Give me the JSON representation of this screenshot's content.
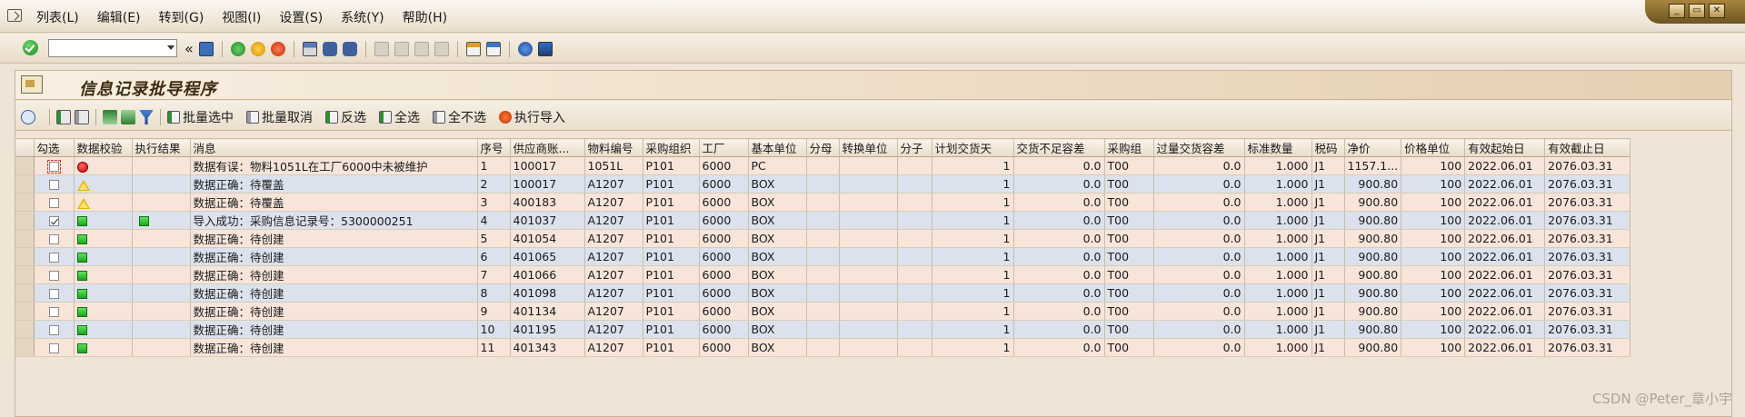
{
  "menubar": {
    "items": [
      "列表(L)",
      "编辑(E)",
      "转到(G)",
      "视图(I)",
      "设置(S)",
      "系统(Y)",
      "帮助(H)"
    ],
    "window_controls": [
      "_",
      "▭",
      "✕"
    ]
  },
  "systoolbar": {
    "command_value": "",
    "nav_symbol": "«"
  },
  "page": {
    "title": "信息记录批导程序"
  },
  "apptoolbar": {
    "items": [
      "批量选中",
      "批量取消",
      "反选",
      "全选",
      "全不选",
      "执行导入"
    ]
  },
  "grid": {
    "columns": [
      "勾选",
      "数据校验",
      "执行结果",
      "消息",
      "序号",
      "供应商账...",
      "物料编号",
      "采购组织",
      "工厂",
      "基本单位",
      "分母",
      "转换单位",
      "分子",
      "计划交货天",
      "交货不足容差",
      "采购组",
      "过量交货容差",
      "标准数量",
      "税码",
      "净价",
      "价格单位",
      "有效起始日",
      "有效截止日"
    ],
    "rows": [
      {
        "checked": false,
        "focus": true,
        "check": "red",
        "result": "",
        "msg": "数据有误：物料1051L在工厂6000中未被维护",
        "seq": "1",
        "vendor": "100017",
        "material": "1051L",
        "porg": "P101",
        "plant": "6000",
        "unit": "PC",
        "denom": "",
        "conv": "",
        "numer": "",
        "days": "1",
        "under": "0.0",
        "pgroup": "T00",
        "over": "0.0",
        "stdqty": "1.000",
        "tax": "J1",
        "price": "1157.1...",
        "punit": "100",
        "from": "2022.06.01",
        "to": "2076.03.31"
      },
      {
        "checked": false,
        "focus": false,
        "check": "yellow",
        "result": "",
        "msg": "数据正确：待覆盖",
        "seq": "2",
        "vendor": "100017",
        "material": "A1207",
        "porg": "P101",
        "plant": "6000",
        "unit": "BOX",
        "denom": "",
        "conv": "",
        "numer": "",
        "days": "1",
        "under": "0.0",
        "pgroup": "T00",
        "over": "0.0",
        "stdqty": "1.000",
        "tax": "J1",
        "price": "900.80",
        "punit": "100",
        "from": "2022.06.01",
        "to": "2076.03.31"
      },
      {
        "checked": false,
        "focus": false,
        "check": "yellow",
        "result": "",
        "msg": "数据正确：待覆盖",
        "seq": "3",
        "vendor": "400183",
        "material": "A1207",
        "porg": "P101",
        "plant": "6000",
        "unit": "BOX",
        "denom": "",
        "conv": "",
        "numer": "",
        "days": "1",
        "under": "0.0",
        "pgroup": "T00",
        "over": "0.0",
        "stdqty": "1.000",
        "tax": "J1",
        "price": "900.80",
        "punit": "100",
        "from": "2022.06.01",
        "to": "2076.03.31"
      },
      {
        "checked": true,
        "focus": false,
        "check": "green",
        "result": "green",
        "msg": "导入成功：采购信息记录号：5300000251",
        "seq": "4",
        "vendor": "401037",
        "material": "A1207",
        "porg": "P101",
        "plant": "6000",
        "unit": "BOX",
        "denom": "",
        "conv": "",
        "numer": "",
        "days": "1",
        "under": "0.0",
        "pgroup": "T00",
        "over": "0.0",
        "stdqty": "1.000",
        "tax": "J1",
        "price": "900.80",
        "punit": "100",
        "from": "2022.06.01",
        "to": "2076.03.31"
      },
      {
        "checked": false,
        "focus": false,
        "check": "green",
        "result": "",
        "msg": "数据正确：待创建",
        "seq": "5",
        "vendor": "401054",
        "material": "A1207",
        "porg": "P101",
        "plant": "6000",
        "unit": "BOX",
        "denom": "",
        "conv": "",
        "numer": "",
        "days": "1",
        "under": "0.0",
        "pgroup": "T00",
        "over": "0.0",
        "stdqty": "1.000",
        "tax": "J1",
        "price": "900.80",
        "punit": "100",
        "from": "2022.06.01",
        "to": "2076.03.31"
      },
      {
        "checked": false,
        "focus": false,
        "check": "green",
        "result": "",
        "msg": "数据正确：待创建",
        "seq": "6",
        "vendor": "401065",
        "material": "A1207",
        "porg": "P101",
        "plant": "6000",
        "unit": "BOX",
        "denom": "",
        "conv": "",
        "numer": "",
        "days": "1",
        "under": "0.0",
        "pgroup": "T00",
        "over": "0.0",
        "stdqty": "1.000",
        "tax": "J1",
        "price": "900.80",
        "punit": "100",
        "from": "2022.06.01",
        "to": "2076.03.31"
      },
      {
        "checked": false,
        "focus": false,
        "check": "green",
        "result": "",
        "msg": "数据正确：待创建",
        "seq": "7",
        "vendor": "401066",
        "material": "A1207",
        "porg": "P101",
        "plant": "6000",
        "unit": "BOX",
        "denom": "",
        "conv": "",
        "numer": "",
        "days": "1",
        "under": "0.0",
        "pgroup": "T00",
        "over": "0.0",
        "stdqty": "1.000",
        "tax": "J1",
        "price": "900.80",
        "punit": "100",
        "from": "2022.06.01",
        "to": "2076.03.31"
      },
      {
        "checked": false,
        "focus": false,
        "check": "green",
        "result": "",
        "msg": "数据正确：待创建",
        "seq": "8",
        "vendor": "401098",
        "material": "A1207",
        "porg": "P101",
        "plant": "6000",
        "unit": "BOX",
        "denom": "",
        "conv": "",
        "numer": "",
        "days": "1",
        "under": "0.0",
        "pgroup": "T00",
        "over": "0.0",
        "stdqty": "1.000",
        "tax": "J1",
        "price": "900.80",
        "punit": "100",
        "from": "2022.06.01",
        "to": "2076.03.31"
      },
      {
        "checked": false,
        "focus": false,
        "check": "green",
        "result": "",
        "msg": "数据正确：待创建",
        "seq": "9",
        "vendor": "401134",
        "material": "A1207",
        "porg": "P101",
        "plant": "6000",
        "unit": "BOX",
        "denom": "",
        "conv": "",
        "numer": "",
        "days": "1",
        "under": "0.0",
        "pgroup": "T00",
        "over": "0.0",
        "stdqty": "1.000",
        "tax": "J1",
        "price": "900.80",
        "punit": "100",
        "from": "2022.06.01",
        "to": "2076.03.31"
      },
      {
        "checked": false,
        "focus": false,
        "check": "green",
        "result": "",
        "msg": "数据正确：待创建",
        "seq": "10",
        "vendor": "401195",
        "material": "A1207",
        "porg": "P101",
        "plant": "6000",
        "unit": "BOX",
        "denom": "",
        "conv": "",
        "numer": "",
        "days": "1",
        "under": "0.0",
        "pgroup": "T00",
        "over": "0.0",
        "stdqty": "1.000",
        "tax": "J1",
        "price": "900.80",
        "punit": "100",
        "from": "2022.06.01",
        "to": "2076.03.31"
      },
      {
        "checked": false,
        "focus": false,
        "check": "green",
        "result": "",
        "msg": "数据正确：待创建",
        "seq": "11",
        "vendor": "401343",
        "material": "A1207",
        "porg": "P101",
        "plant": "6000",
        "unit": "BOX",
        "denom": "",
        "conv": "",
        "numer": "",
        "days": "1",
        "under": "0.0",
        "pgroup": "T00",
        "over": "0.0",
        "stdqty": "1.000",
        "tax": "J1",
        "price": "900.80",
        "punit": "100",
        "from": "2022.06.01",
        "to": "2076.03.31"
      }
    ]
  },
  "watermark": "CSDN @Peter_章小宇"
}
